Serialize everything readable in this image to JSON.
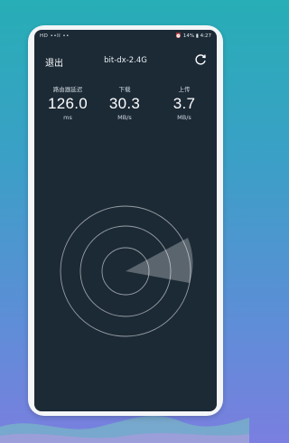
{
  "status_bar": {
    "left": "HD ••ll ••",
    "right": "⏰ 14% ▮ 4:27"
  },
  "header": {
    "exit_label": "退出",
    "title": "bit-dx-2.4G",
    "refresh_icon": "refresh-icon"
  },
  "metrics": {
    "latency": {
      "label": "路由器延迟",
      "value": "126.0",
      "unit": "ms"
    },
    "download": {
      "label": "下载",
      "value": "30.3",
      "unit": "MB/s"
    },
    "upload": {
      "label": "上传",
      "value": "3.7",
      "unit": "MB/s"
    }
  },
  "colors": {
    "screen_bg": "#1c2a36",
    "accent_wave": "#ffffff"
  }
}
